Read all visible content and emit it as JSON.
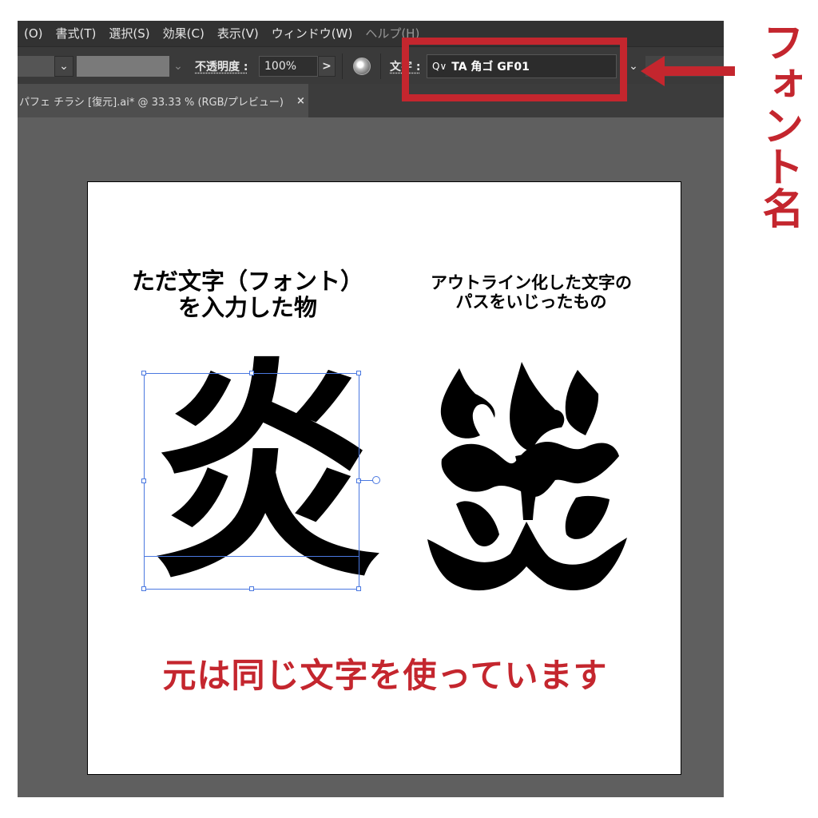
{
  "menu": [
    "(O)",
    "書式(T)",
    "選択(S)",
    "効果(C)",
    "表示(V)",
    "ウィンドウ(W)",
    "ヘルプ(H)"
  ],
  "controlbar": {
    "opacity_label": "不透明度 :",
    "opacity_value": "100%",
    "opacity_arrow": ">",
    "char_label": "文字 :",
    "font_search_icon": "Q∨",
    "font_name": "TA 角ゴ GF01",
    "chevron": "⌄"
  },
  "tab": {
    "title": "パフェ チラシ [復元].ai* @ 33.33 % (RGB/プレビュー)",
    "close": "×"
  },
  "artboard": {
    "caption_left": [
      "ただ文字（フォント）",
      "を入力した物"
    ],
    "caption_right": [
      "アウトライン化した文字の",
      "パスをいじったもの"
    ],
    "glyph": "炎",
    "note": "元は同じ文字を使っています"
  },
  "annotation": {
    "callout": "フォント名",
    "accent_color": "#c4262e",
    "selection_color": "#4a78e0"
  }
}
